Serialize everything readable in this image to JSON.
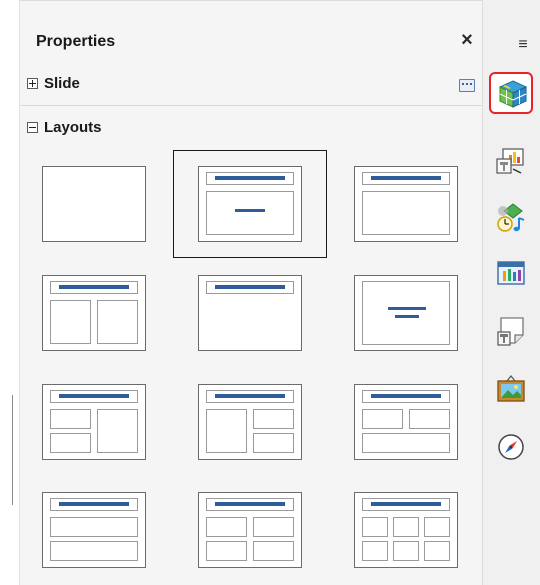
{
  "panel": {
    "title": "Properties",
    "close_label": "×",
    "sections": [
      {
        "label": "Slide",
        "state": "collapsed"
      },
      {
        "label": "Layouts",
        "state": "expanded"
      }
    ]
  },
  "layouts": {
    "selected_index": 1,
    "items": [
      "blank",
      "title-content",
      "title-only",
      "title-two-content",
      "title-only-top",
      "centered-text",
      "title-content-two",
      "title-two-content-right",
      "title-two-content-top-wide",
      "title-two-stacked",
      "title-four-content",
      "title-six-content"
    ]
  },
  "deck": {
    "menu_icon": "sidebar-menu-icon",
    "buttons": [
      {
        "icon": "properties-cube-icon",
        "active": true
      },
      {
        "icon": "slide-transition-icon",
        "active": false
      },
      {
        "icon": "animation-icon",
        "active": false
      },
      {
        "icon": "master-slides-icon",
        "active": false
      },
      {
        "icon": "styles-icon",
        "active": false
      },
      {
        "icon": "gallery-icon",
        "active": false
      },
      {
        "icon": "navigator-icon",
        "active": false
      }
    ]
  },
  "colors": {
    "accent_bar": "#2e5d9a",
    "active_outline": "#e8242a"
  }
}
